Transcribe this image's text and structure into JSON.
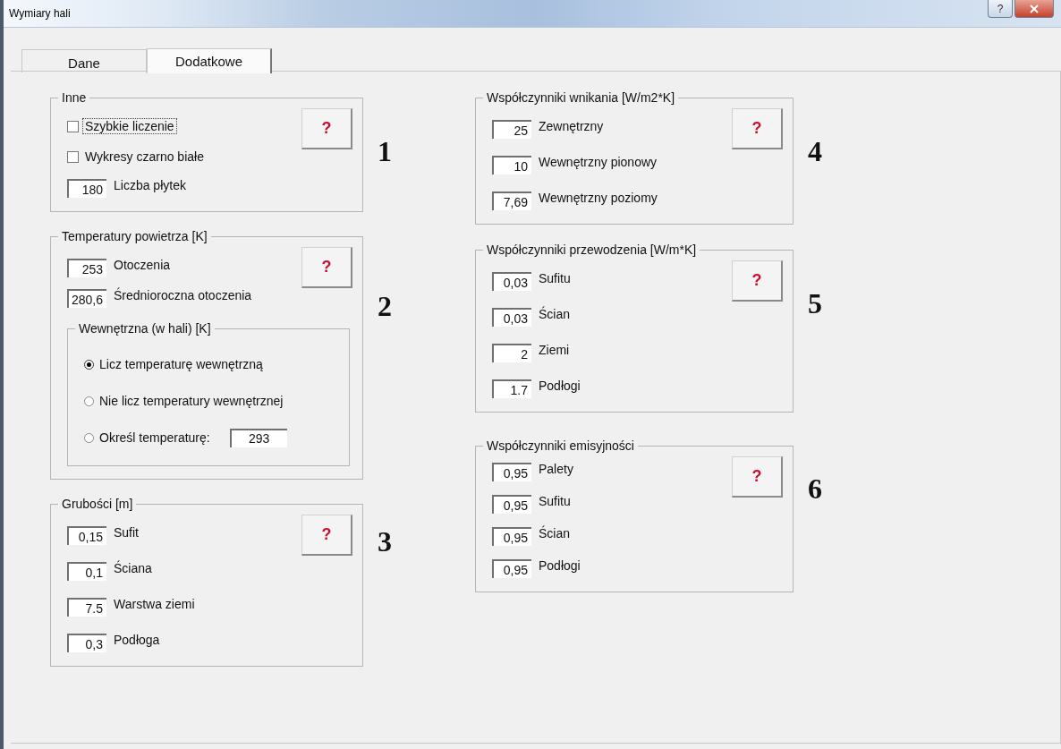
{
  "window": {
    "title": "Wymiary hali",
    "help_button": "?"
  },
  "tabs": [
    {
      "label": "Dane",
      "selected": false
    },
    {
      "label": "Dodatkowe",
      "selected": true
    }
  ],
  "columns": [
    {
      "groups": [
        {
          "title": "Inne",
          "help": "?",
          "number": "1",
          "items": [
            {
              "kind": "checkbox",
              "label": "Szybkie liczenie",
              "checked": false,
              "focused": true
            },
            {
              "kind": "checkbox",
              "label": "Wykresy czarno białe",
              "checked": false,
              "focused": false
            },
            {
              "kind": "field",
              "value": "180",
              "label": "Liczba płytek"
            }
          ]
        },
        {
          "title": "Temperatury powietrza [K]",
          "help": "?",
          "number": "2",
          "items": [
            {
              "kind": "field",
              "value": "253",
              "label": "Otoczenia"
            },
            {
              "kind": "field",
              "value": "280,6",
              "label": "Średnioroczna otoczenia"
            },
            {
              "kind": "subgroup",
              "title": "Wewnętrzna (w hali) [K]",
              "items": [
                {
                  "kind": "radio",
                  "label": "Licz temperaturę wewnętrzną",
                  "selected": true
                },
                {
                  "kind": "radio",
                  "label": "Nie licz temperatury wewnętrznej",
                  "selected": false
                },
                {
                  "kind": "radio",
                  "label": "Określ temperaturę:",
                  "selected": false,
                  "value": "293"
                }
              ]
            }
          ]
        },
        {
          "title": "Grubości [m]",
          "help": "?",
          "number": "3",
          "items": [
            {
              "kind": "field",
              "value": "0,15",
              "label": "Sufit"
            },
            {
              "kind": "field",
              "value": "0,1",
              "label": "Ściana"
            },
            {
              "kind": "field",
              "value": "7.5",
              "label": "Warstwa ziemi"
            },
            {
              "kind": "field",
              "value": "0,3",
              "label": "Podłoga"
            }
          ]
        }
      ]
    },
    {
      "groups": [
        {
          "title": "Współczynniki wnikania [W/m2*K]",
          "help": "?",
          "number": "4",
          "items": [
            {
              "kind": "field",
              "value": "25",
              "label": "Zewnętrzny"
            },
            {
              "kind": "field",
              "value": "10",
              "label": "Wewnętrzny pionowy"
            },
            {
              "kind": "field",
              "value": "7,69",
              "label": "Wewnętrzny poziomy"
            }
          ]
        },
        {
          "title": "Współczynniki przewodzenia [W/m*K]",
          "help": "?",
          "number": "5",
          "items": [
            {
              "kind": "field",
              "value": "0,03",
              "label": "Sufitu"
            },
            {
              "kind": "field",
              "value": "0,03",
              "label": "Ścian"
            },
            {
              "kind": "field",
              "value": "2",
              "label": "Ziemi"
            },
            {
              "kind": "field",
              "value": "1.7",
              "label": "Podłogi"
            }
          ]
        },
        {
          "title": "Współczynniki emisyjności",
          "help": "?",
          "number": "6",
          "items": [
            {
              "kind": "field",
              "value": "0,95",
              "label": "Palety"
            },
            {
              "kind": "field",
              "value": "0,95",
              "label": "Sufitu"
            },
            {
              "kind": "field",
              "value": "0,95",
              "label": "Ścian"
            },
            {
              "kind": "field",
              "value": "0,95",
              "label": "Podłogi"
            }
          ]
        }
      ]
    }
  ]
}
